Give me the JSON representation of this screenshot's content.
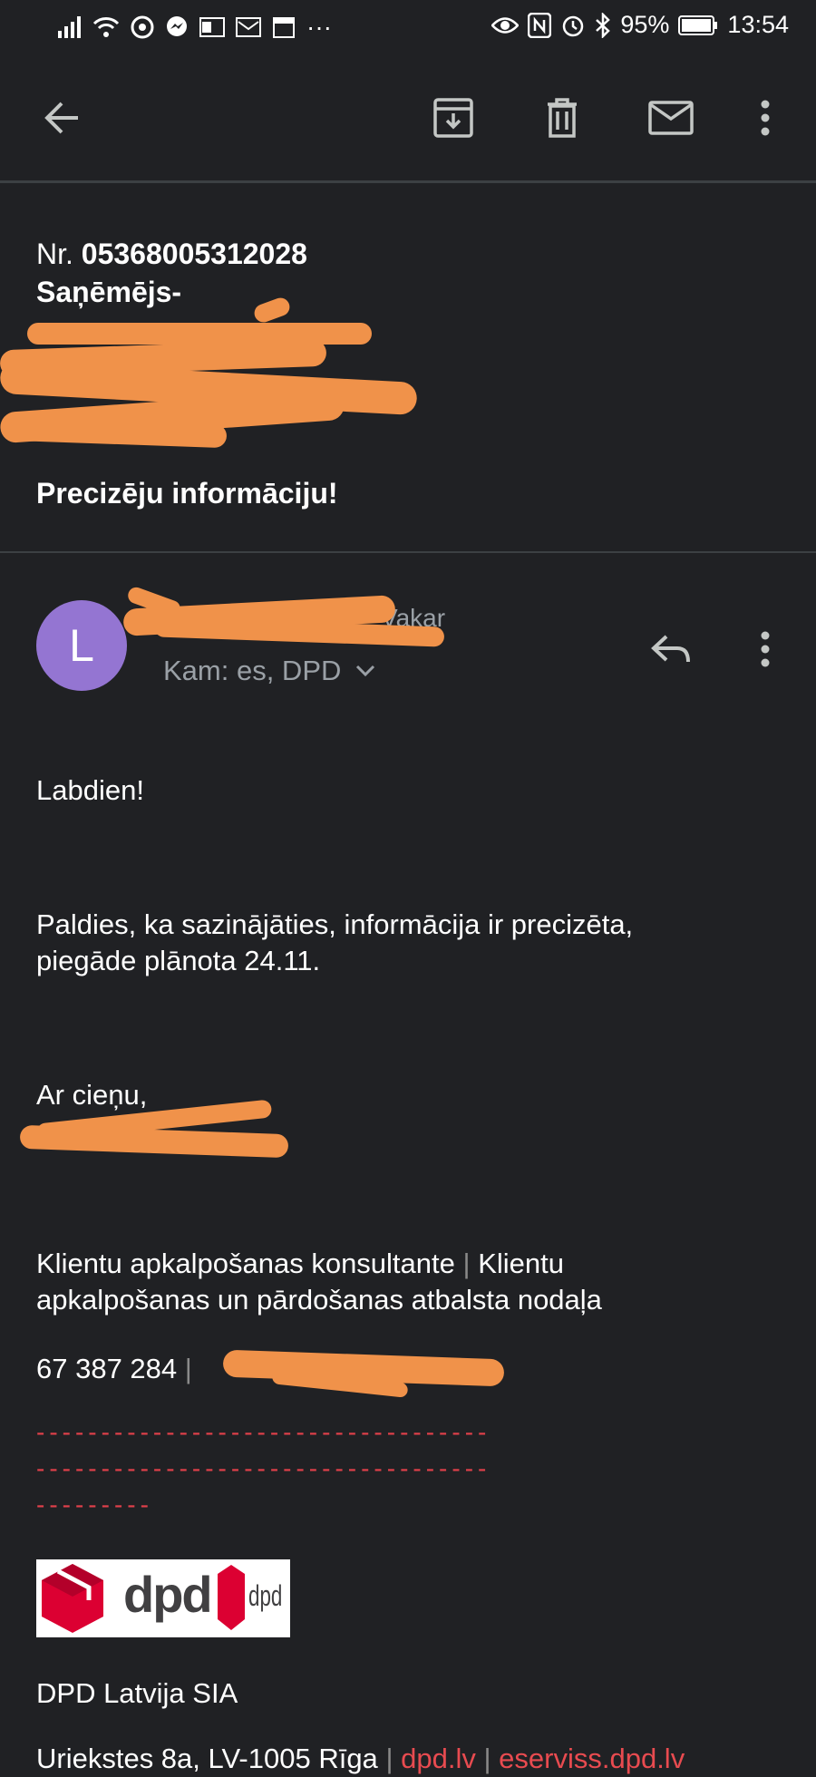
{
  "status_bar": {
    "battery": "95%",
    "time": "13:54"
  },
  "toolbar": {
    "back_icon": "arrow-back-icon",
    "archive_icon": "archive-icon",
    "delete_icon": "trash-icon",
    "mark_unread_icon": "mail-icon",
    "more_icon": "more-vert-icon"
  },
  "subject": {
    "nr_label": "Nr.",
    "nr_value": "05368005312028",
    "recipient_label": "Saņēmējs-",
    "title": "Precizēju informāciju!"
  },
  "sender": {
    "avatar_letter": "L",
    "date": "Vakar",
    "to_line": "Kam: es, DPD"
  },
  "message": {
    "greeting": "Labdien!",
    "line1": "Paldies, ka sazinājāties, informācija ir precizēta,",
    "line2": "piegāde plānota 24.11.",
    "closing": "Ar cieņu,",
    "role_line1_a": "Klientu apkalpošanas konsultante",
    "role_line1_b": "Klientu",
    "role_line2": "apkalpošanas un pārdošanas atbalsta nodaļa",
    "phone": "67 387 284",
    "separator": "|",
    "dashes1": "-----------------------------------",
    "dashes2": "-----------------------------------",
    "dashes3": "---------",
    "company": "DPD Latvija SIA",
    "address": "Uriekstes 8a, LV-1005 Rīga",
    "link1": "dpd.lv",
    "link2": "eserviss.dpd.lv"
  },
  "logo": {
    "text": "dpd",
    "small_text": "dpd"
  },
  "colors": {
    "background": "#202124",
    "avatar": "#9475d2",
    "link_red": "#e84b50",
    "redaction": "#f0924a"
  }
}
